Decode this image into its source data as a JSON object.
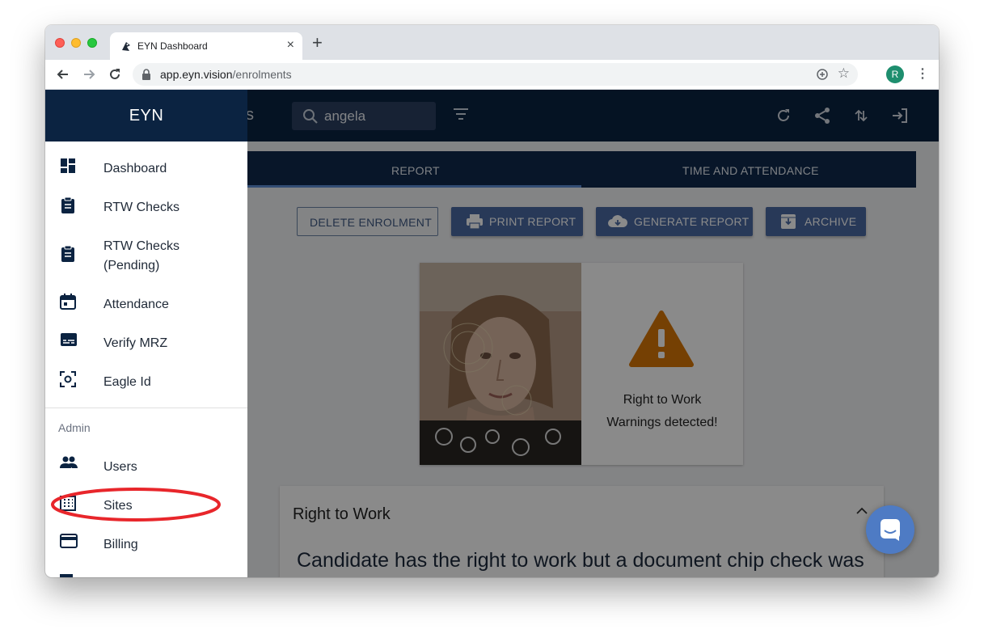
{
  "browser": {
    "tab_title": "EYN Dashboard",
    "url_host": "app.eyn.vision",
    "url_path": "/enrolments",
    "profile_initial": "R"
  },
  "app": {
    "title_partial": "cks",
    "search_value": "angela",
    "tabs": [
      {
        "label": "REPORT",
        "active": true
      },
      {
        "label": "TIME AND ATTENDANCE",
        "active": false
      }
    ],
    "actions": {
      "delete": "DELETE ENROLMENT",
      "print": "PRINT REPORT",
      "generate": "GENERATE REPORT",
      "archive": "ARCHIVE"
    },
    "card": {
      "warning_line1": "Right to Work",
      "warning_line2": "Warnings detected!"
    },
    "rtw_section": {
      "title": "Right to Work",
      "body": "Candidate has the right to work but a document chip check was"
    }
  },
  "drawer": {
    "brand": "EYN",
    "items": [
      {
        "label": "Dashboard",
        "icon": "dashboard-icon"
      },
      {
        "label": "RTW Checks",
        "icon": "clipboard-icon"
      },
      {
        "label": "RTW Checks\n(Pending)",
        "icon": "clipboard-icon"
      },
      {
        "label": "Attendance",
        "icon": "calendar-icon"
      },
      {
        "label": "Verify MRZ",
        "icon": "mrz-icon"
      },
      {
        "label": "Eagle Id",
        "icon": "scan-icon"
      }
    ],
    "admin_header": "Admin",
    "admin_items": [
      {
        "label": "Users",
        "icon": "people-icon"
      },
      {
        "label": "Sites",
        "icon": "building-icon"
      },
      {
        "label": "Billing",
        "icon": "credit-card-icon"
      }
    ]
  },
  "colors": {
    "navy": "#0b2341",
    "accent": "#4a6aa3",
    "warning": "#d97706",
    "annotation": "#e8262b"
  }
}
